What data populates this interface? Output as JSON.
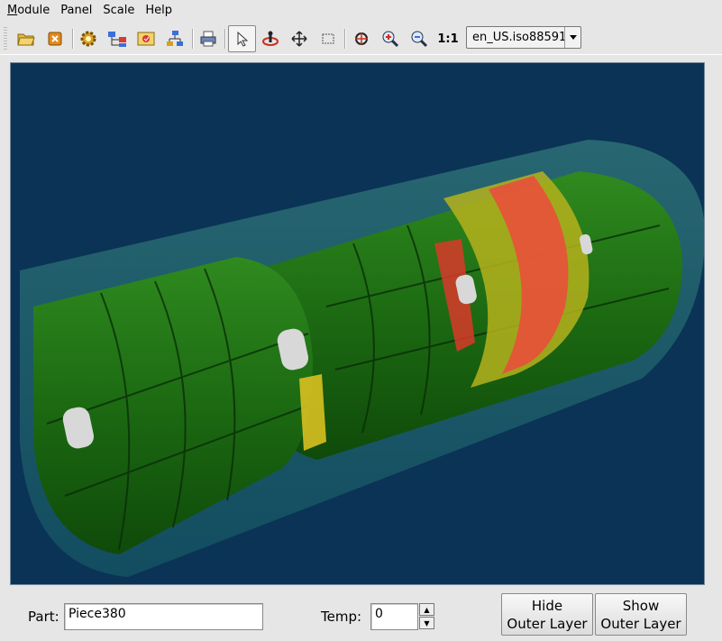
{
  "menu": [
    {
      "mnemonic": "M",
      "rest": "odule"
    },
    {
      "mnemonic": "",
      "rest": "Panel"
    },
    {
      "mnemonic": "",
      "rest": "Scale"
    },
    {
      "mnemonic": "",
      "rest": "Help"
    }
  ],
  "toolbar": {
    "icons": [
      "open-folder-icon",
      "close-icon",
      "settings-gear-icon",
      "tree-view-icon",
      "image-browse-icon",
      "hierarchy-icon",
      "print-icon",
      "select-arrow-icon",
      "rotate-icon",
      "pan-move-icon",
      "zoom-box-icon",
      "center-view-icon",
      "zoom-in-icon",
      "zoom-out-icon"
    ],
    "zoom_reset_label": "1:1",
    "locale_value": "en_US.iso88591"
  },
  "bottom": {
    "part_label": "Part:",
    "part_value": "Piece380",
    "temp_label": "Temp:",
    "temp_value": "0",
    "hide_button_line1": "Hide",
    "hide_button_line2": "Outer Layer",
    "show_button_line1": "Show",
    "show_button_line2": "Outer Layer"
  },
  "colors": {
    "viewport_bg": "#0b3356",
    "inner_green": "#1f6e14",
    "outer_teal": "#3fb39a",
    "hot_red": "#e8503a",
    "warm_yellow": "#b5b21c",
    "ring_white": "#d8d8d8"
  }
}
